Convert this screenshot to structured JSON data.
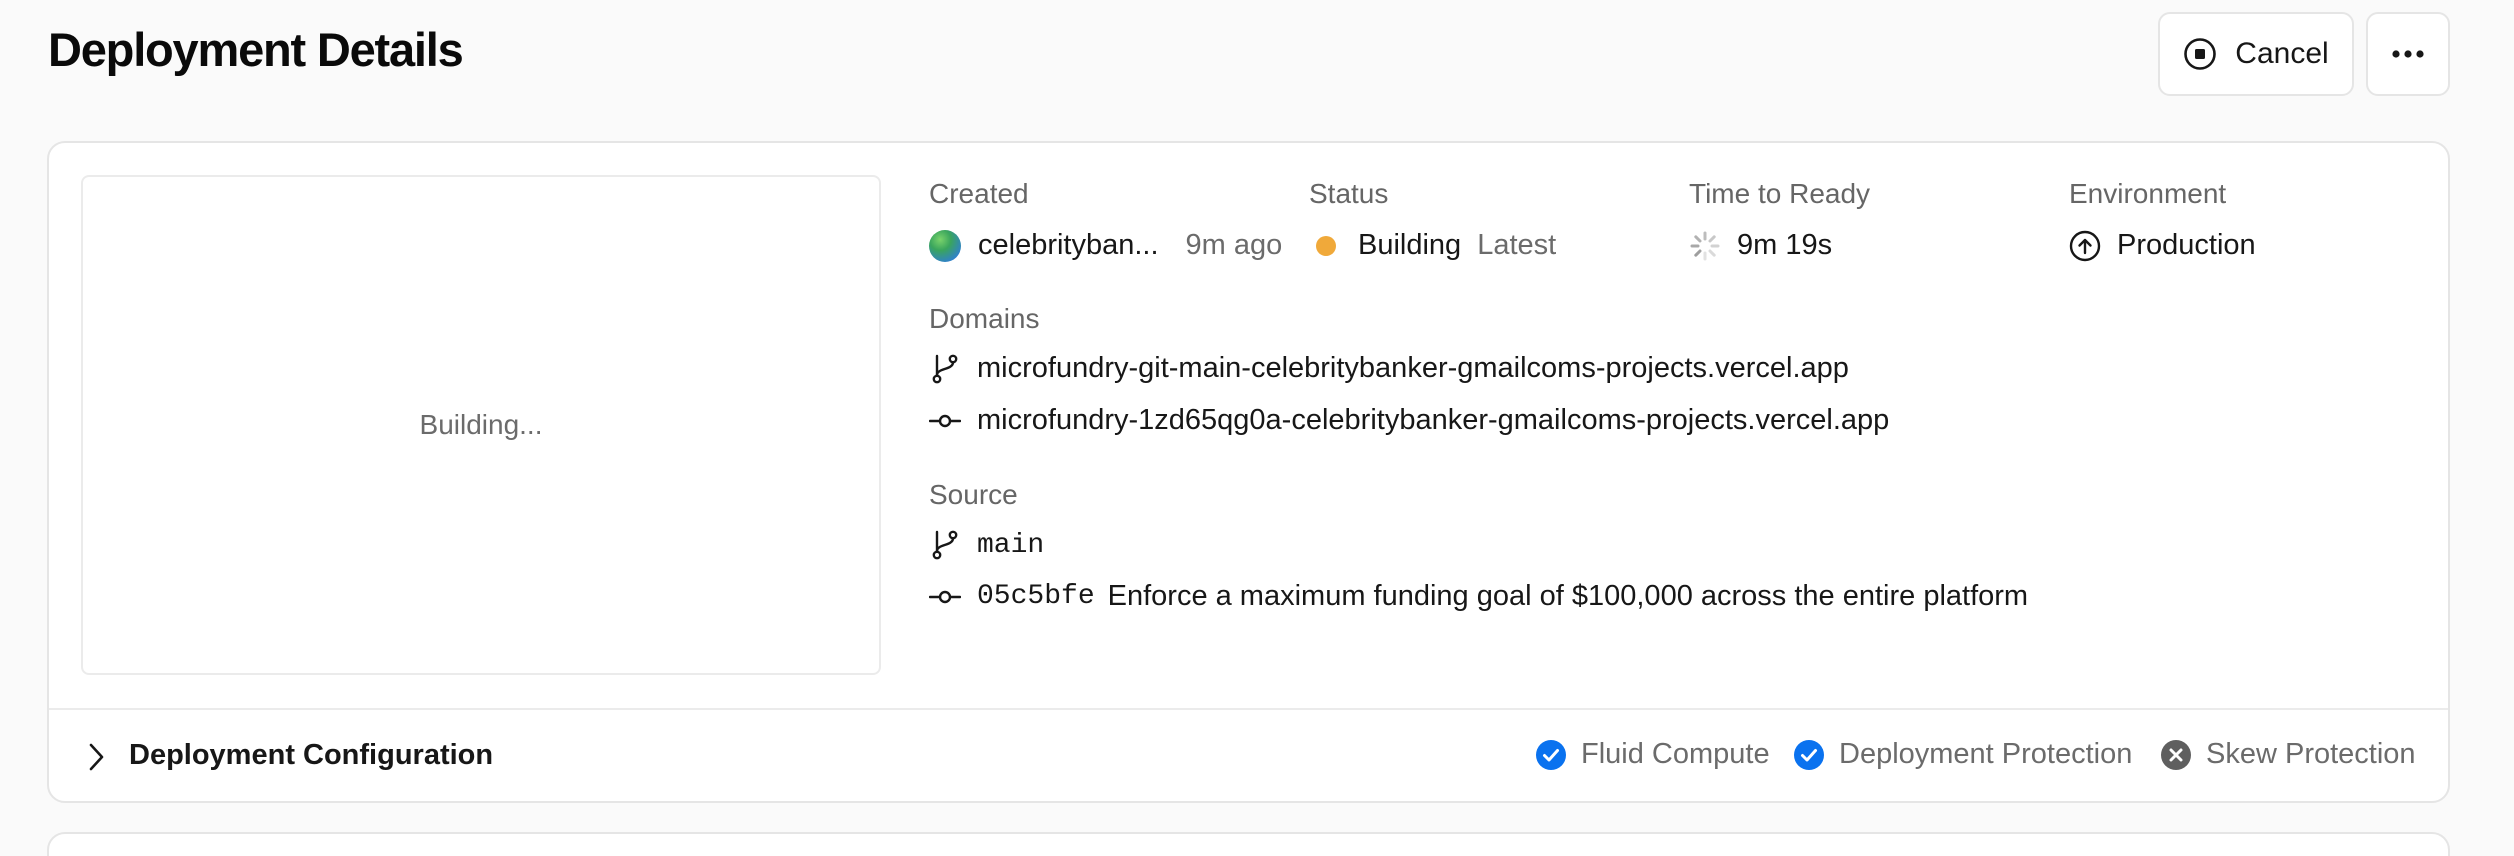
{
  "header": {
    "title": "Deployment Details",
    "cancel_label": "Cancel",
    "more_icon": "ellipsis-icon"
  },
  "preview": {
    "status_text": "Building..."
  },
  "created": {
    "label": "Created",
    "user": "celebrityban...",
    "time": "9m ago"
  },
  "status": {
    "label": "Status",
    "value": "Building",
    "tag": "Latest",
    "color": "#f0a93a"
  },
  "time_to_ready": {
    "label": "Time to Ready",
    "value": "9m 19s"
  },
  "environment": {
    "label": "Environment",
    "value": "Production"
  },
  "domains": {
    "label": "Domains",
    "items": [
      {
        "icon": "git-branch-icon",
        "text": "microfundry-git-main-celebritybanker-gmailcoms-projects.vercel.app"
      },
      {
        "icon": "git-commit-icon",
        "text": "microfundry-1zd65qg0a-celebritybanker-gmailcoms-projects.vercel.app"
      }
    ]
  },
  "source": {
    "label": "Source",
    "branch": "main",
    "commit_hash": "05c5bfe",
    "commit_message": "Enforce a maximum funding goal of $100,000 across the entire platform"
  },
  "config": {
    "title": "Deployment Configuration",
    "features": [
      {
        "name": "Fluid Compute",
        "enabled": true,
        "color": "#0a72ef"
      },
      {
        "name": "Deployment Protection",
        "enabled": true,
        "color": "#0a72ef"
      },
      {
        "name": "Skew Protection",
        "enabled": false,
        "color": "#5f5f5f"
      }
    ]
  }
}
